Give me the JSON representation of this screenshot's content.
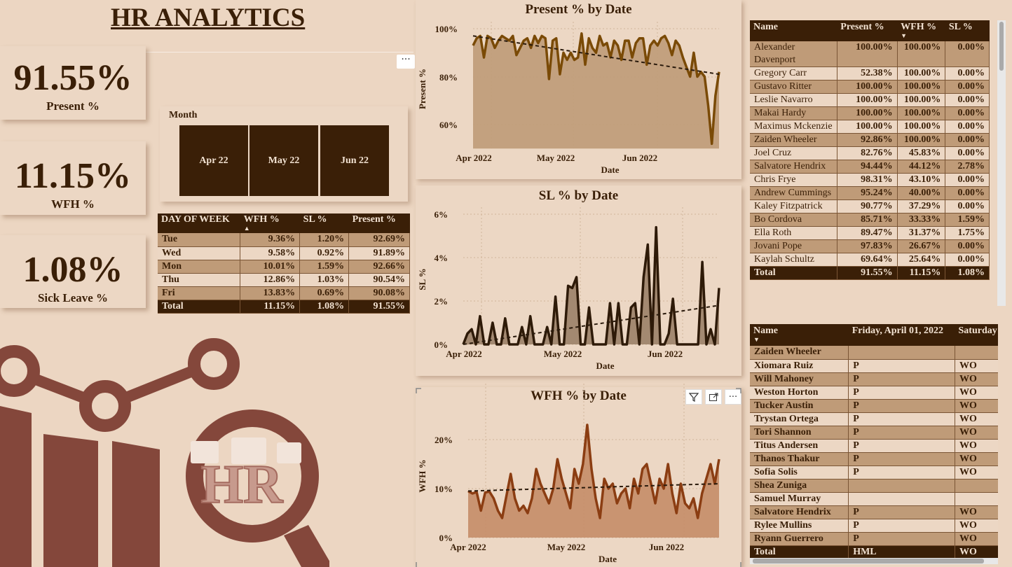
{
  "title": "HR ANALYTICS",
  "kpis": [
    {
      "value": "91.55%",
      "label": "Present %"
    },
    {
      "value": "11.15%",
      "label": "WFH %"
    },
    {
      "value": "1.08%",
      "label": "Sick Leave %"
    }
  ],
  "more_options": "···",
  "slicer": {
    "header": "Month",
    "items": [
      "Apr 22",
      "May 22",
      "Jun 22"
    ]
  },
  "dow_table": {
    "headers": [
      "DAY OF WEEK",
      "WFH %",
      "SL %",
      "Present %"
    ],
    "rows": [
      [
        "Tue",
        "9.36%",
        "1.20%",
        "92.69%"
      ],
      [
        "Wed",
        "9.58%",
        "0.92%",
        "91.89%"
      ],
      [
        "Mon",
        "10.01%",
        "1.59%",
        "92.66%"
      ],
      [
        "Thu",
        "12.86%",
        "1.03%",
        "90.54%"
      ],
      [
        "Fri",
        "13.83%",
        "0.69%",
        "90.08%"
      ]
    ],
    "total": [
      "Total",
      "11.15%",
      "1.08%",
      "91.55%"
    ]
  },
  "charts": {
    "present": {
      "title": "Present % by Date",
      "xlabel": "Date",
      "ylabel": "Present %",
      "yticks": [
        "100%",
        "80%",
        "60%"
      ],
      "xticks": [
        "Apr 2022",
        "May 2022",
        "Jun 2022"
      ]
    },
    "sl": {
      "title": "SL % by Date",
      "xlabel": "Date",
      "ylabel": "SL %",
      "yticks": [
        "6%",
        "4%",
        "2%",
        "0%"
      ],
      "xticks": [
        "Apr 2022",
        "May 2022",
        "Jun 2022"
      ]
    },
    "wfh": {
      "title": "WFH % by Date",
      "xlabel": "Date",
      "ylabel": "WFH %",
      "yticks": [
        "20%",
        "10%",
        "0%"
      ],
      "xticks": [
        "Apr 2022",
        "May 2022",
        "Jun 2022"
      ]
    }
  },
  "chart_data": [
    {
      "type": "area",
      "title": "Present % by Date",
      "xlabel": "Date",
      "ylabel": "Present %",
      "ylim": [
        50,
        100
      ],
      "x_range": [
        "2022-04-01",
        "2022-06-30"
      ],
      "values": [
        93,
        96,
        97,
        88,
        97,
        96,
        92,
        95,
        97,
        96,
        95,
        97,
        89,
        92,
        95,
        96,
        92,
        97,
        94,
        97,
        96,
        79,
        95,
        96,
        81,
        90,
        87,
        90,
        87,
        88,
        98,
        85,
        96,
        92,
        90,
        97,
        93,
        94,
        88,
        95,
        93,
        87,
        95,
        95,
        88,
        94,
        96,
        96,
        85,
        93,
        95,
        93,
        96,
        97,
        94,
        89,
        95,
        93,
        88,
        84,
        80,
        90,
        80,
        82,
        80,
        68,
        52,
        72,
        82
      ],
      "trend": {
        "start": 97,
        "end": 81
      },
      "color": "#7a4a06"
    },
    {
      "type": "area",
      "title": "SL % by Date",
      "xlabel": "Date",
      "ylabel": "SL %",
      "ylim": [
        0,
        6
      ],
      "x_range": [
        "2022-04-01",
        "2022-06-30"
      ],
      "values": [
        0,
        0.5,
        0.7,
        0,
        1.3,
        0,
        0,
        1,
        0,
        0,
        1.2,
        0,
        0,
        0,
        0.8,
        0,
        1.3,
        0,
        0,
        0,
        0.8,
        0,
        2.2,
        0,
        0,
        2.7,
        2.6,
        3.1,
        0,
        0,
        1.7,
        0,
        0,
        0,
        0,
        1.9,
        0,
        1.9,
        0,
        0,
        1.7,
        1.9,
        0,
        3.1,
        4.6,
        0,
        5.4,
        0,
        0,
        0.5,
        2.1,
        0,
        0,
        0,
        0,
        0,
        0,
        3.8,
        0,
        0.7,
        0,
        2.6
      ],
      "trend": {
        "start": 0,
        "end": 1.8
      },
      "color": "#2e1a08"
    },
    {
      "type": "area",
      "title": "WFH % by Date",
      "xlabel": "Date",
      "ylabel": "WFH %",
      "ylim": [
        0,
        25
      ],
      "x_range": [
        "2022-04-01",
        "2022-06-30"
      ],
      "values": [
        9.5,
        9,
        9.3,
        5.5,
        9.2,
        9.4,
        8,
        5.5,
        4,
        8.5,
        13,
        8,
        5.5,
        6.5,
        5,
        8,
        14,
        11,
        9,
        7,
        10,
        16,
        12,
        9,
        6,
        14,
        11,
        15,
        23,
        14,
        8,
        4,
        12,
        10,
        11,
        7,
        9,
        10,
        6,
        12,
        9,
        14,
        15,
        11,
        7,
        12,
        10,
        15,
        9,
        5,
        11,
        7,
        6,
        8,
        4,
        9,
        12,
        15,
        11,
        16
      ],
      "trend": {
        "start": 9.5,
        "end": 11
      },
      "color": "#8b3d12"
    }
  ],
  "employee_table": {
    "headers": [
      "Name",
      "Present %",
      "WFH %",
      "SL %"
    ],
    "rows": [
      [
        "Alexander Davenport",
        "100.00%",
        "100.00%",
        "0.00%"
      ],
      [
        "Gregory Carr",
        "52.38%",
        "100.00%",
        "0.00%"
      ],
      [
        "Gustavo Ritter",
        "100.00%",
        "100.00%",
        "0.00%"
      ],
      [
        "Leslie Navarro",
        "100.00%",
        "100.00%",
        "0.00%"
      ],
      [
        "Makai Hardy",
        "100.00%",
        "100.00%",
        "0.00%"
      ],
      [
        "Maximus Mckenzie",
        "100.00%",
        "100.00%",
        "0.00%"
      ],
      [
        "Zaiden Wheeler",
        "92.86%",
        "100.00%",
        "0.00%"
      ],
      [
        "Joel Cruz",
        "82.76%",
        "45.83%",
        "0.00%"
      ],
      [
        "Salvatore Hendrix",
        "94.44%",
        "44.12%",
        "2.78%"
      ],
      [
        "Chris Frye",
        "98.31%",
        "43.10%",
        "0.00%"
      ],
      [
        "Andrew Cummings",
        "95.24%",
        "40.00%",
        "0.00%"
      ],
      [
        "Kaley Fitzpatrick",
        "90.77%",
        "37.29%",
        "0.00%"
      ],
      [
        "Bo Cordova",
        "85.71%",
        "33.33%",
        "1.59%"
      ],
      [
        "Ella Roth",
        "89.47%",
        "31.37%",
        "1.75%"
      ],
      [
        "Jovani Pope",
        "97.83%",
        "26.67%",
        "0.00%"
      ],
      [
        "Kaylah Schultz",
        "69.64%",
        "25.64%",
        "0.00%"
      ]
    ],
    "total": [
      "Total",
      "91.55%",
      "11.15%",
      "1.08%"
    ]
  },
  "attendance_table": {
    "headers": [
      "Name",
      "Friday, April 01, 2022",
      "Saturday"
    ],
    "rows": [
      [
        "Zaiden Wheeler",
        "",
        ""
      ],
      [
        "Xiomara Ruiz",
        "P",
        "WO"
      ],
      [
        "Will Mahoney",
        "P",
        "WO"
      ],
      [
        "Weston Horton",
        "P",
        "WO"
      ],
      [
        "Tucker Austin",
        "P",
        "WO"
      ],
      [
        "Trystan Ortega",
        "P",
        "WO"
      ],
      [
        "Tori Shannon",
        "P",
        "WO"
      ],
      [
        "Titus Andersen",
        "P",
        "WO"
      ],
      [
        "Thanos Thakur",
        "P",
        "WO"
      ],
      [
        "Sofia Solis",
        "P",
        "WO"
      ],
      [
        "Shea Zuniga",
        "",
        ""
      ],
      [
        "Samuel Murray",
        "",
        ""
      ],
      [
        "Salvatore Hendrix",
        "P",
        "WO"
      ],
      [
        "Rylee Mullins",
        "P",
        "WO"
      ],
      [
        "Ryann Guerrero",
        "P",
        "WO"
      ]
    ],
    "total": [
      "Total",
      "HML",
      "WO"
    ]
  },
  "logo_text": "HR"
}
